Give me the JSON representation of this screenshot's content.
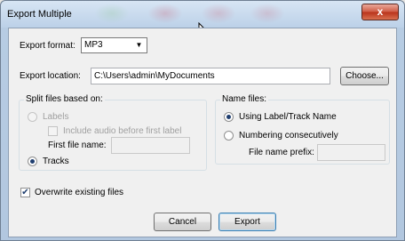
{
  "window": {
    "title": "Export Multiple",
    "close_glyph": "x"
  },
  "export_format": {
    "label": "Export format:",
    "value": "MP3"
  },
  "export_location": {
    "label": "Export location:",
    "value": "C:\\Users\\admin\\MyDocuments",
    "choose_label": "Choose..."
  },
  "split_group": {
    "legend": "Split files based on:",
    "labels_option": "Labels",
    "include_audio_label": "Include audio before first label",
    "first_file_name_label": "First file name:",
    "first_file_name_value": "",
    "tracks_option": "Tracks",
    "selected": "Tracks"
  },
  "name_group": {
    "legend": "Name files:",
    "using_label_option": "Using Label/Track Name",
    "numbering_option": "Numbering consecutively",
    "prefix_label": "File name prefix:",
    "prefix_value": "",
    "selected": "Using Label/Track Name"
  },
  "overwrite": {
    "label": "Overwrite existing files",
    "checked": true,
    "check_glyph": "✔"
  },
  "buttons": {
    "cancel": "Cancel",
    "export": "Export"
  }
}
